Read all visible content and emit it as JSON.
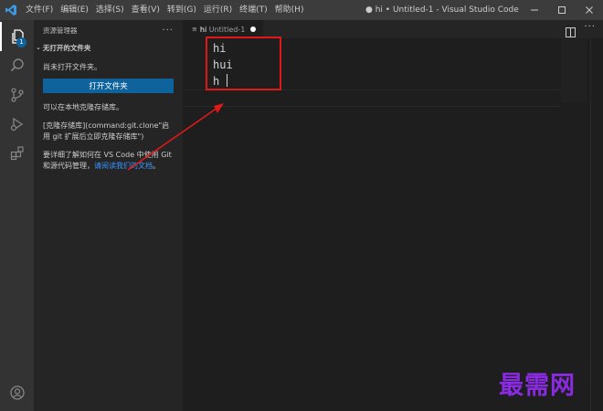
{
  "menu": [
    "文件(F)",
    "编辑(E)",
    "选择(S)",
    "查看(V)",
    "转到(G)",
    "运行(R)",
    "终端(T)",
    "帮助(H)"
  ],
  "window_title": "● hi • Untitled-1 - Visual Studio Code",
  "activity": {
    "explorer_badge": "1"
  },
  "sidebar": {
    "title": "资源管理器",
    "more": "···",
    "section": "无打开的文件夹",
    "no_folder": "尚未打开文件夹。",
    "open_button": "打开文件夹",
    "clone_text": "可以在本地克隆存储库。",
    "clone_cmd": "[克隆存储库](command:git.clone\"启用 git 扩展后立即克隆存储库\")",
    "learn_prefix": "要详细了解如何在 VS Code 中使用 Git 和源代码管理，",
    "learn_link": "请阅读我们的文档",
    "learn_suffix": "。"
  },
  "editor": {
    "tab_icon": "≡",
    "tab_name": "hi",
    "tab_file": "Untitled-1",
    "lines": [
      "hi",
      "hui",
      "h"
    ]
  },
  "colors": {
    "accent": "#0e639c",
    "annotation": "#e01818",
    "watermark": "#8a2be2"
  },
  "watermark": "最需网"
}
